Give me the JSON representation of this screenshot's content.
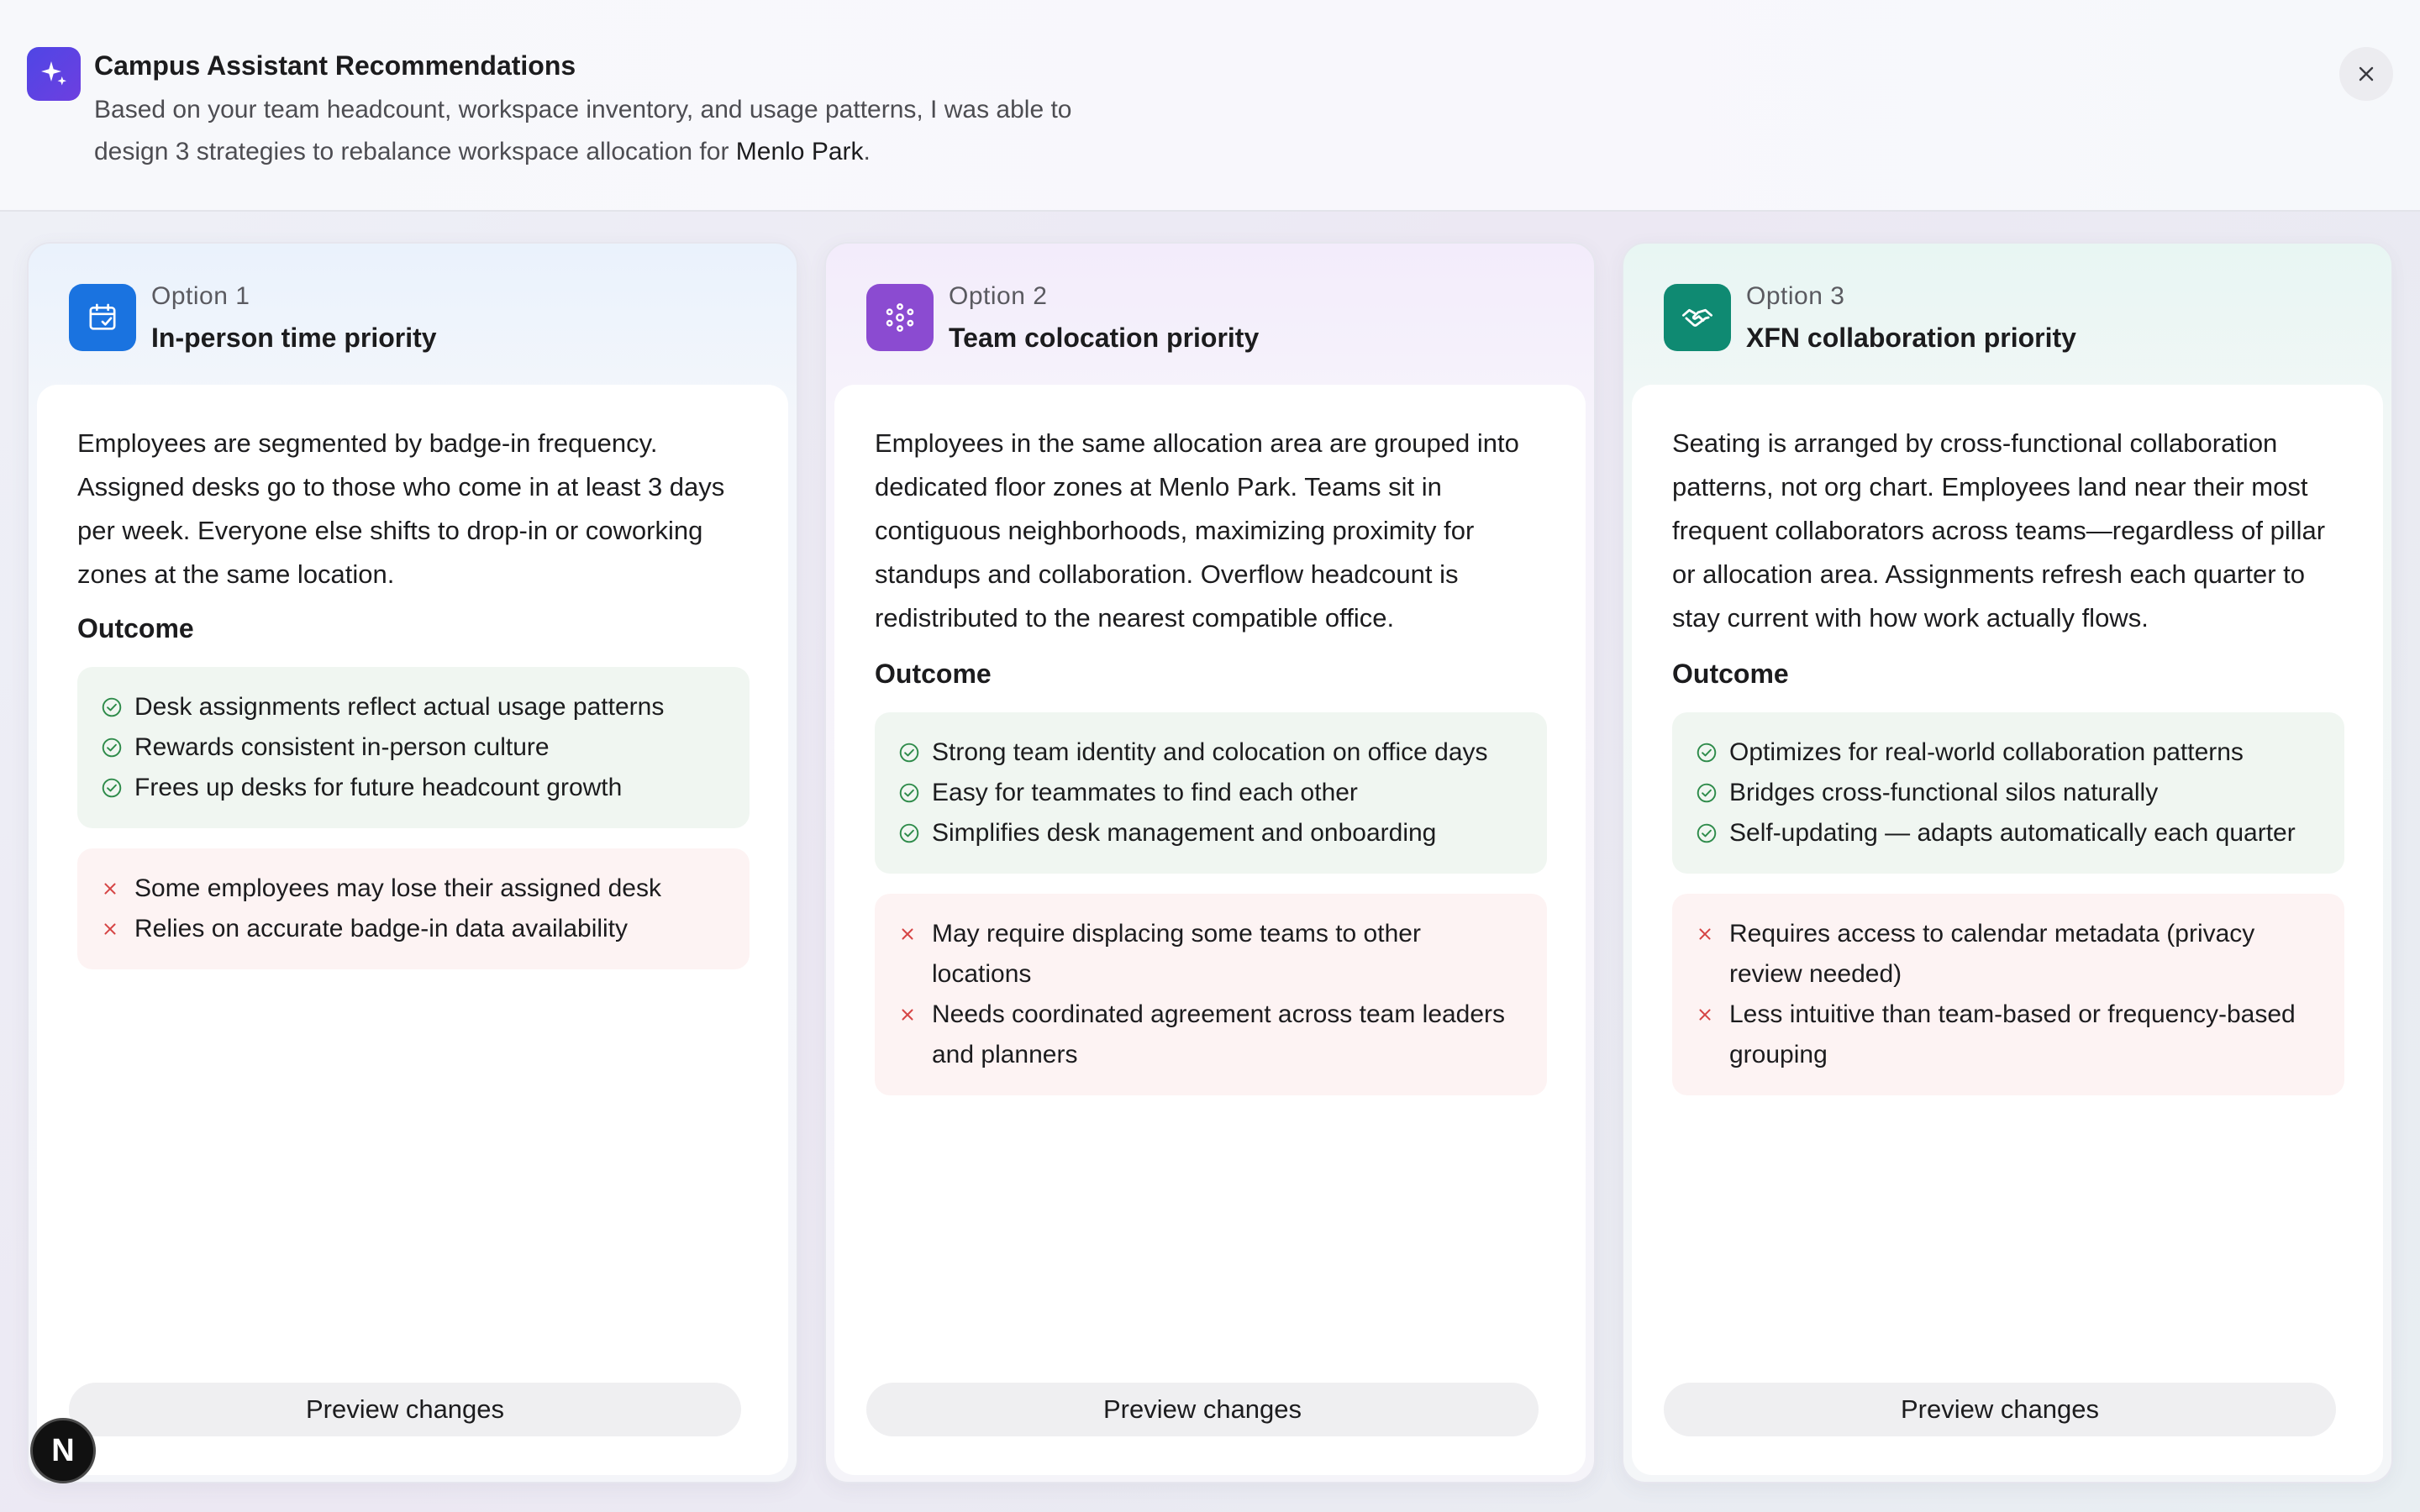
{
  "header": {
    "title": "Campus Assistant Recommendations",
    "desc_line1": "Based on your team headcount, workspace inventory, and usage patterns, I was able to",
    "desc_line2_prefix": "design 3 strategies to rebalance workspace allocation for ",
    "location": "Menlo Park",
    "desc_suffix": ".",
    "icon": "sparkle-icon",
    "accent": "#4f46e5"
  },
  "options": [
    {
      "label": "Option 1",
      "title": "In-person time priority",
      "icon": "calendar-check-icon",
      "color": "#1a73e0",
      "description": "Employees are segmented by badge-in frequency. Assigned desks go to those who come in at least 3 days per week. Everyone else shifts to drop-in or coworking zones at the same location.",
      "outcome_label": "Outcome",
      "pros": [
        "Desk assignments reflect actual usage patterns",
        "Rewards consistent in-person culture",
        "Frees up desks for future headcount growth"
      ],
      "cons": [
        "Some employees may lose their assigned desk",
        "Relies on accurate badge-in data availability"
      ],
      "button": "Preview changes"
    },
    {
      "label": "Option 2",
      "title": "Team colocation priority",
      "icon": "team-cluster-icon",
      "color": "#8b4bd1",
      "description": "Employees in the same allocation area are grouped into dedicated floor zones at Menlo Park. Teams sit in contiguous neighborhoods, maximizing proximity for standups and collaboration. Overflow headcount is redistributed to the nearest compatible office.",
      "outcome_label": "Outcome",
      "pros": [
        "Strong team identity and colocation on office days",
        "Easy for teammates to find each other",
        "Simplifies desk management and onboarding"
      ],
      "cons": [
        "May require displacing some teams to other locations",
        "Needs coordinated agreement across team leaders and planners"
      ],
      "button": "Preview changes"
    },
    {
      "label": "Option 3",
      "title": "XFN collaboration priority",
      "icon": "handshake-icon",
      "color": "#0f8a72",
      "description": "Seating is arranged by cross-functional collaboration patterns, not org chart. Employees land near their most frequent collaborators across teams—regardless of pillar or allocation area. Assignments refresh each quarter to stay current with how work actually flows.",
      "outcome_label": "Outcome",
      "pros": [
        "Optimizes for real-world collaboration patterns",
        "Bridges cross-functional silos naturally",
        "Self-updating — adapts automatically each quarter"
      ],
      "cons": [
        "Requires access to calendar metadata (privacy review needed)",
        "Less intuitive than team-based or frequency-based grouping"
      ],
      "button": "Preview changes"
    }
  ],
  "badge": {
    "letter": "N"
  }
}
